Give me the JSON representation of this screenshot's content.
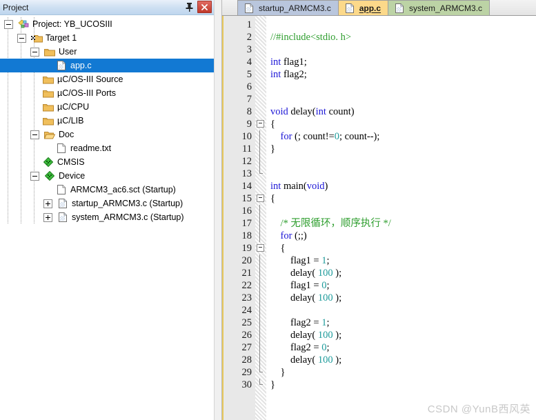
{
  "panel": {
    "title": "Project",
    "pin_icon": "pushpin-icon",
    "close_icon": "close-icon",
    "tree": [
      {
        "label": "Project: YB_UCOSIII",
        "depth": 0,
        "expander": "minus",
        "icon": "project-icon",
        "selected": false
      },
      {
        "label": "Target 1",
        "depth": 1,
        "expander": "minus",
        "icon": "target-folder-icon",
        "selected": false
      },
      {
        "label": "User",
        "depth": 2,
        "expander": "minus",
        "icon": "folder-icon",
        "selected": false
      },
      {
        "label": "app.c",
        "depth": 3,
        "expander": "none",
        "icon": "c-file-icon",
        "selected": true
      },
      {
        "label": "µC/OS-III Source",
        "depth": 2,
        "expander": "none",
        "icon": "folder-icon",
        "selected": false
      },
      {
        "label": "µC/OS-III Ports",
        "depth": 2,
        "expander": "none",
        "icon": "folder-icon",
        "selected": false
      },
      {
        "label": "µC/CPU",
        "depth": 2,
        "expander": "none",
        "icon": "folder-icon",
        "selected": false
      },
      {
        "label": "µC/LIB",
        "depth": 2,
        "expander": "none",
        "icon": "folder-icon",
        "selected": false
      },
      {
        "label": "Doc",
        "depth": 2,
        "expander": "minus",
        "icon": "folder-open-icon",
        "selected": false
      },
      {
        "label": "readme.txt",
        "depth": 3,
        "expander": "none",
        "icon": "text-file-icon",
        "selected": false
      },
      {
        "label": "CMSIS",
        "depth": 2,
        "expander": "none",
        "icon": "diamond-icon",
        "selected": false
      },
      {
        "label": "Device",
        "depth": 2,
        "expander": "minus",
        "icon": "diamond-icon",
        "selected": false
      },
      {
        "label": "ARMCM3_ac6.sct (Startup)",
        "depth": 3,
        "expander": "none",
        "icon": "text-file-icon",
        "selected": false
      },
      {
        "label": "startup_ARMCM3.c (Startup)",
        "depth": 3,
        "expander": "plus",
        "icon": "c-file-icon",
        "selected": false
      },
      {
        "label": "system_ARMCM3.c (Startup)",
        "depth": 3,
        "expander": "plus",
        "icon": "c-file-icon",
        "selected": false
      }
    ]
  },
  "editor": {
    "tabs": [
      {
        "label": "startup_ARMCM3.c",
        "style": "t-blue",
        "active": false
      },
      {
        "label": "app.c",
        "style": "t-gold",
        "active": true
      },
      {
        "label": "system_ARMCM3.c",
        "style": "t-green",
        "active": false
      }
    ],
    "line_numbers": [
      1,
      2,
      3,
      4,
      5,
      6,
      7,
      8,
      9,
      10,
      11,
      12,
      13,
      14,
      15,
      16,
      17,
      18,
      19,
      20,
      21,
      22,
      23,
      24,
      25,
      26,
      27,
      28,
      29,
      30
    ],
    "lines": [
      {
        "n": 1,
        "tokens": []
      },
      {
        "n": 2,
        "tokens": [
          {
            "t": "//#include<stdio. h>",
            "c": "cm"
          }
        ]
      },
      {
        "n": 3,
        "tokens": []
      },
      {
        "n": 4,
        "tokens": [
          {
            "t": "int",
            "c": "kw"
          },
          {
            "t": " flag1;",
            "c": ""
          }
        ]
      },
      {
        "n": 5,
        "tokens": [
          {
            "t": "int",
            "c": "kw"
          },
          {
            "t": " flag2;",
            "c": ""
          }
        ]
      },
      {
        "n": 6,
        "tokens": []
      },
      {
        "n": 7,
        "tokens": []
      },
      {
        "n": 8,
        "tokens": [
          {
            "t": "void",
            "c": "kw"
          },
          {
            "t": " delay(",
            "c": ""
          },
          {
            "t": "int",
            "c": "kw"
          },
          {
            "t": " count)",
            "c": ""
          }
        ]
      },
      {
        "n": 9,
        "tokens": [
          {
            "t": "{",
            "c": ""
          }
        ]
      },
      {
        "n": 10,
        "tokens": [
          {
            "t": "    ",
            "c": ""
          },
          {
            "t": "for",
            "c": "kw"
          },
          {
            "t": " (; count!=",
            "c": ""
          },
          {
            "t": "0",
            "c": "num"
          },
          {
            "t": "; count--);",
            "c": ""
          }
        ]
      },
      {
        "n": 11,
        "tokens": [
          {
            "t": "}",
            "c": ""
          }
        ]
      },
      {
        "n": 12,
        "tokens": []
      },
      {
        "n": 13,
        "tokens": []
      },
      {
        "n": 14,
        "tokens": [
          {
            "t": "int",
            "c": "kw"
          },
          {
            "t": " main(",
            "c": ""
          },
          {
            "t": "void",
            "c": "kw"
          },
          {
            "t": ")",
            "c": ""
          }
        ]
      },
      {
        "n": 15,
        "tokens": [
          {
            "t": "{",
            "c": ""
          }
        ]
      },
      {
        "n": 16,
        "tokens": []
      },
      {
        "n": 17,
        "tokens": [
          {
            "t": "    ",
            "c": ""
          },
          {
            "t": "/* 无限循环，顺序执行 */",
            "c": "cm"
          }
        ]
      },
      {
        "n": 18,
        "tokens": [
          {
            "t": "    ",
            "c": ""
          },
          {
            "t": "for",
            "c": "kw"
          },
          {
            "t": " (;;)",
            "c": ""
          }
        ]
      },
      {
        "n": 19,
        "tokens": [
          {
            "t": "    {",
            "c": ""
          }
        ]
      },
      {
        "n": 20,
        "tokens": [
          {
            "t": "        flag1 = ",
            "c": ""
          },
          {
            "t": "1",
            "c": "num"
          },
          {
            "t": ";",
            "c": ""
          }
        ]
      },
      {
        "n": 21,
        "tokens": [
          {
            "t": "        delay( ",
            "c": ""
          },
          {
            "t": "100",
            "c": "num"
          },
          {
            "t": " );",
            "c": ""
          }
        ]
      },
      {
        "n": 22,
        "tokens": [
          {
            "t": "        flag1 = ",
            "c": ""
          },
          {
            "t": "0",
            "c": "num"
          },
          {
            "t": ";",
            "c": ""
          }
        ]
      },
      {
        "n": 23,
        "tokens": [
          {
            "t": "        delay( ",
            "c": ""
          },
          {
            "t": "100",
            "c": "num"
          },
          {
            "t": " );",
            "c": ""
          }
        ]
      },
      {
        "n": 24,
        "tokens": []
      },
      {
        "n": 25,
        "tokens": [
          {
            "t": "        flag2 = ",
            "c": ""
          },
          {
            "t": "1",
            "c": "num"
          },
          {
            "t": ";",
            "c": ""
          }
        ]
      },
      {
        "n": 26,
        "tokens": [
          {
            "t": "        delay( ",
            "c": ""
          },
          {
            "t": "100",
            "c": "num"
          },
          {
            "t": " );",
            "c": ""
          }
        ]
      },
      {
        "n": 27,
        "tokens": [
          {
            "t": "        flag2 = ",
            "c": ""
          },
          {
            "t": "0",
            "c": "num"
          },
          {
            "t": ";",
            "c": ""
          }
        ]
      },
      {
        "n": 28,
        "tokens": [
          {
            "t": "        delay( ",
            "c": ""
          },
          {
            "t": "100",
            "c": "num"
          },
          {
            "t": " );",
            "c": ""
          }
        ]
      },
      {
        "n": 29,
        "tokens": [
          {
            "t": "    }",
            "c": ""
          }
        ]
      },
      {
        "n": 30,
        "tokens": [
          {
            "t": "}",
            "c": ""
          }
        ]
      }
    ],
    "fold_markers": [
      {
        "line": 9,
        "type": "box"
      },
      {
        "line": 10,
        "type": "line"
      },
      {
        "line": 11,
        "type": "line"
      },
      {
        "line": 12,
        "type": "line"
      },
      {
        "line": 13,
        "type": "end"
      },
      {
        "line": 15,
        "type": "box"
      },
      {
        "line": 16,
        "type": "line"
      },
      {
        "line": 17,
        "type": "line"
      },
      {
        "line": 18,
        "type": "line"
      },
      {
        "line": 19,
        "type": "box"
      },
      {
        "line": 20,
        "type": "line"
      },
      {
        "line": 21,
        "type": "line"
      },
      {
        "line": 22,
        "type": "line"
      },
      {
        "line": 23,
        "type": "line"
      },
      {
        "line": 24,
        "type": "line"
      },
      {
        "line": 25,
        "type": "line"
      },
      {
        "line": 26,
        "type": "line"
      },
      {
        "line": 27,
        "type": "line"
      },
      {
        "line": 28,
        "type": "line"
      },
      {
        "line": 29,
        "type": "end"
      },
      {
        "line": 30,
        "type": "end"
      }
    ]
  },
  "watermark": "CSDN @YunB西风英",
  "colors": {
    "selection": "#1279d3",
    "keyword": "#1b15d6",
    "comment": "#2f9e2f",
    "number": "#1b9a9a",
    "tab_active": "#fcd98a",
    "accent_bar": "#e8c85a"
  }
}
